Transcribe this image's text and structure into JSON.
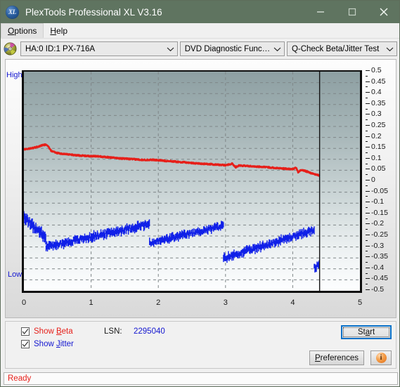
{
  "window": {
    "title": "PlexTools Professional XL V3.16",
    "icon": "xl-disc-icon",
    "icon_text": "XL",
    "minimize_label": "minimize-icon",
    "maximize_label": "maximize-icon",
    "close_label": "close-icon",
    "titlebar_color": "#5f7460"
  },
  "menu": {
    "items": [
      {
        "label": "Options",
        "accel": "O"
      },
      {
        "label": "Help",
        "accel": "H"
      }
    ]
  },
  "toolbar": {
    "drive_icon": "optical-disc-icon",
    "drive": {
      "value": "HA:0 ID:1  PX-716A"
    },
    "function": {
      "value": "DVD Diagnostic Functions"
    },
    "test": {
      "value": "Q-Check Beta/Jitter Test"
    }
  },
  "chart_labels": {
    "high": "High",
    "low": "Low"
  },
  "controls": {
    "show_beta": {
      "label_pre": "Show ",
      "label_accel": "B",
      "label_post": "eta",
      "checked": true,
      "color": "#e61f19"
    },
    "show_jitter": {
      "label_pre": "Show ",
      "label_accel": "J",
      "label_post": "itter",
      "checked": true,
      "color": "#1417d0"
    },
    "lsn_label": "LSN:",
    "lsn_value": "2295040",
    "start_pre": "St",
    "start_accel": "a",
    "start_post": "rt",
    "prefs_pre": "",
    "prefs_accel": "P",
    "prefs_post": "references",
    "info_label": "i",
    "info_name": "info-button"
  },
  "status": {
    "text": "Ready",
    "color": "#e61f19"
  },
  "chart_data": {
    "type": "line",
    "title": "Q-Check Beta/Jitter Test",
    "xlabel": "",
    "ylabel": "",
    "xlim": [
      0,
      5
    ],
    "ylim": [
      -0.5,
      0.5
    ],
    "xticks": [
      0,
      1,
      2,
      3,
      4,
      5
    ],
    "yticks": [
      0.5,
      0.45,
      0.4,
      0.35,
      0.3,
      0.25,
      0.2,
      0.15,
      0.1,
      0.05,
      0,
      -0.05,
      -0.1,
      -0.15,
      -0.2,
      -0.25,
      -0.3,
      -0.35,
      -0.4,
      -0.45,
      -0.5
    ],
    "ytick_labels": [
      "0.5",
      "0.45",
      "0.4",
      "0.35",
      "0.3",
      "0.25",
      "0.2",
      "0.15",
      "0.1",
      "0.05",
      "0",
      "-0.05",
      "-0.1",
      "-0.15",
      "-0.2",
      "-0.25",
      "-0.3",
      "-0.35",
      "-0.4",
      "-0.45",
      "-0.5"
    ],
    "grid": true,
    "grid_style": "dashed",
    "legend_position": "bottom-left-checkboxes",
    "data_end_x": 4.4,
    "marker_line_x": 4.4,
    "axis_side": "right",
    "series": [
      {
        "name": "Beta",
        "color": "#e61f19",
        "kind": "line",
        "points": [
          [
            0.0,
            0.145
          ],
          [
            0.05,
            0.147
          ],
          [
            0.1,
            0.15
          ],
          [
            0.15,
            0.152
          ],
          [
            0.2,
            0.157
          ],
          [
            0.25,
            0.162
          ],
          [
            0.3,
            0.166
          ],
          [
            0.33,
            0.167
          ],
          [
            0.36,
            0.16
          ],
          [
            0.4,
            0.14
          ],
          [
            0.45,
            0.133
          ],
          [
            0.5,
            0.128
          ],
          [
            0.6,
            0.124
          ],
          [
            0.7,
            0.121
          ],
          [
            0.8,
            0.118
          ],
          [
            0.9,
            0.116
          ],
          [
            1.0,
            0.114
          ],
          [
            1.1,
            0.114
          ],
          [
            1.2,
            0.111
          ],
          [
            1.3,
            0.108
          ],
          [
            1.4,
            0.105
          ],
          [
            1.5,
            0.103
          ],
          [
            1.6,
            0.101
          ],
          [
            1.7,
            0.099
          ],
          [
            1.8,
            0.097
          ],
          [
            1.9,
            0.098
          ],
          [
            2.0,
            0.096
          ],
          [
            2.1,
            0.093
          ],
          [
            2.2,
            0.091
          ],
          [
            2.3,
            0.088
          ],
          [
            2.4,
            0.086
          ],
          [
            2.5,
            0.083
          ],
          [
            2.6,
            0.081
          ],
          [
            2.7,
            0.079
          ],
          [
            2.8,
            0.077
          ],
          [
            2.9,
            0.075
          ],
          [
            3.0,
            0.073
          ],
          [
            3.1,
            0.08
          ],
          [
            3.15,
            0.064
          ],
          [
            3.2,
            0.072
          ],
          [
            3.3,
            0.07
          ],
          [
            3.4,
            0.068
          ],
          [
            3.5,
            0.066
          ],
          [
            3.6,
            0.064
          ],
          [
            3.7,
            0.062
          ],
          [
            3.8,
            0.059
          ],
          [
            3.9,
            0.057
          ],
          [
            4.0,
            0.055
          ],
          [
            4.05,
            0.062
          ],
          [
            4.08,
            0.04
          ],
          [
            4.12,
            0.052
          ],
          [
            4.15,
            0.05
          ],
          [
            4.2,
            0.045
          ],
          [
            4.25,
            0.04
          ],
          [
            4.3,
            0.034
          ],
          [
            4.35,
            0.03
          ],
          [
            4.4,
            0.026
          ]
        ],
        "noise_amp": 0.006
      },
      {
        "name": "Jitter",
        "color": "#1020e8",
        "kind": "noise-band",
        "segments": [
          {
            "x0": 0.0,
            "x1": 0.33,
            "y0": -0.165,
            "y1": -0.255,
            "band": 0.055
          },
          {
            "x0": 0.33,
            "x1": 1.87,
            "y0": -0.3,
            "y1": -0.195,
            "band": 0.042
          },
          {
            "x0": 1.87,
            "x1": 2.97,
            "y0": -0.283,
            "y1": -0.203,
            "band": 0.038
          },
          {
            "x0": 2.97,
            "x1": 4.32,
            "y0": -0.352,
            "y1": -0.222,
            "band": 0.04
          },
          {
            "x0": 4.32,
            "x1": 4.4,
            "y0": -0.395,
            "y1": -0.383,
            "band": 0.04
          }
        ]
      }
    ]
  }
}
